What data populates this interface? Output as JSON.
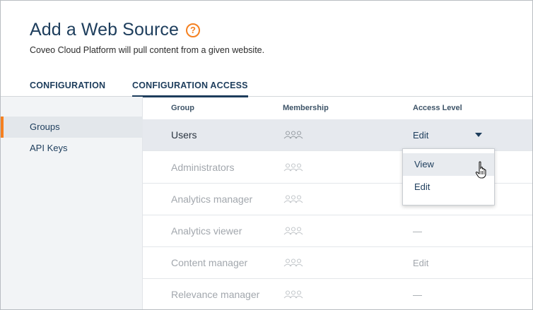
{
  "header": {
    "title": "Add a Web Source",
    "help_icon": "?",
    "subtitle": "Coveo Cloud Platform will pull content from a given website."
  },
  "tabs": [
    {
      "label": "CONFIGURATION",
      "active": false
    },
    {
      "label": "CONFIGURATION ACCESS",
      "active": true
    }
  ],
  "sidebar": {
    "items": [
      {
        "label": "Groups",
        "active": true
      },
      {
        "label": "API Keys",
        "active": false
      }
    ]
  },
  "table": {
    "columns": [
      "Group",
      "Membership",
      "Access Level"
    ],
    "rows": [
      {
        "group": "Users",
        "membership_icon": "members-icon",
        "access": "Edit",
        "selected": true
      },
      {
        "group": "Administrators",
        "membership_icon": "members-icon",
        "access": ""
      },
      {
        "group": "Analytics manager",
        "membership_icon": "members-icon",
        "access": ""
      },
      {
        "group": "Analytics viewer",
        "membership_icon": "members-icon",
        "access": "—"
      },
      {
        "group": "Content manager",
        "membership_icon": "members-icon",
        "access": "Edit"
      },
      {
        "group": "Relevance manager",
        "membership_icon": "members-icon",
        "access": "—"
      }
    ]
  },
  "access_dropdown": {
    "options": [
      "View",
      "Edit"
    ],
    "hovered": "View"
  },
  "colors": {
    "accent": "#f58020",
    "title": "#1d3d5c",
    "muted_text": "#a2a7ad",
    "selected_row": "#e6e9ee",
    "sidebar_bg": "#f2f4f6"
  }
}
